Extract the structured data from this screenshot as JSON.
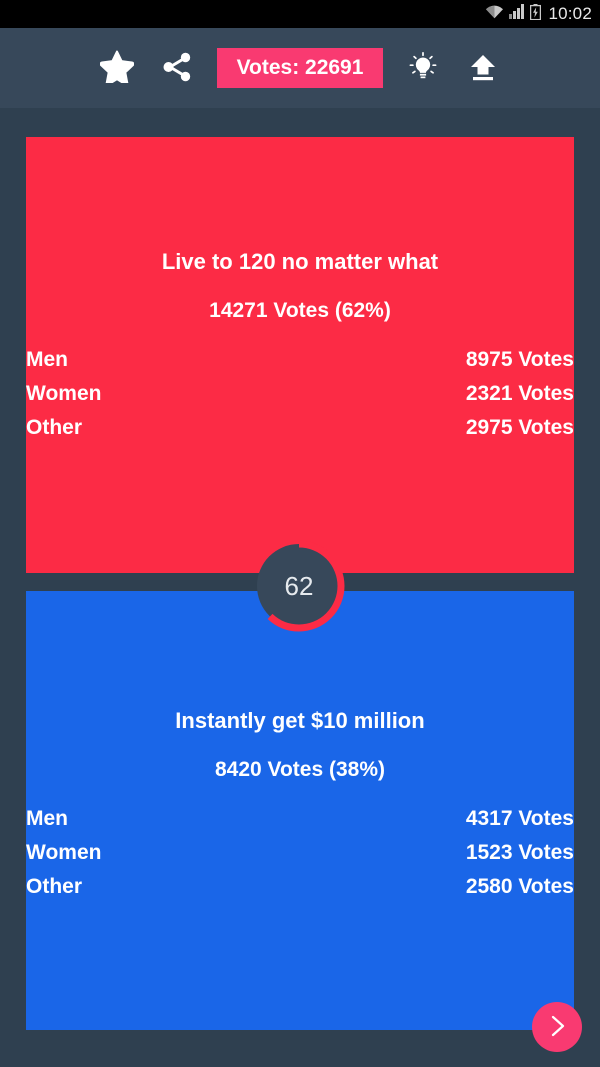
{
  "statusbar": {
    "time": "10:02",
    "icons": [
      "wifi-icon",
      "cellular-signal-icon",
      "battery-charging-icon"
    ]
  },
  "toolbar": {
    "favorite_icon": "star-icon",
    "share_icon": "share-icon",
    "votes_badge_label": "Votes: 22691",
    "suggest_icon": "lightbulb-icon",
    "upload_icon": "upload-icon",
    "badge_color": "#f93a71",
    "background_color": "#37485a"
  },
  "center_gauge": {
    "value": "62",
    "percent": 62,
    "track_color": "#37485a",
    "arc_color": "#fc2b45"
  },
  "options": [
    {
      "title": "Live to 120 no matter what",
      "votes_line": "14271 Votes (62%)",
      "votes": 14271,
      "percent": 62,
      "color": "#fc2b45",
      "breakdown": [
        {
          "label": "Men",
          "value": "8975 Votes"
        },
        {
          "label": "Women",
          "value": "2321 Votes"
        },
        {
          "label": "Other",
          "value": "2975 Votes"
        }
      ]
    },
    {
      "title": "Instantly get $10 million",
      "votes_line": "8420 Votes (38%)",
      "votes": 8420,
      "percent": 38,
      "color": "#1a66e8",
      "breakdown": [
        {
          "label": "Men",
          "value": "4317 Votes"
        },
        {
          "label": "Women",
          "value": "1523 Votes"
        },
        {
          "label": "Other",
          "value": "2580 Votes"
        }
      ]
    }
  ],
  "fab": {
    "icon": "chevron-right-icon",
    "color": "#f93a71"
  }
}
